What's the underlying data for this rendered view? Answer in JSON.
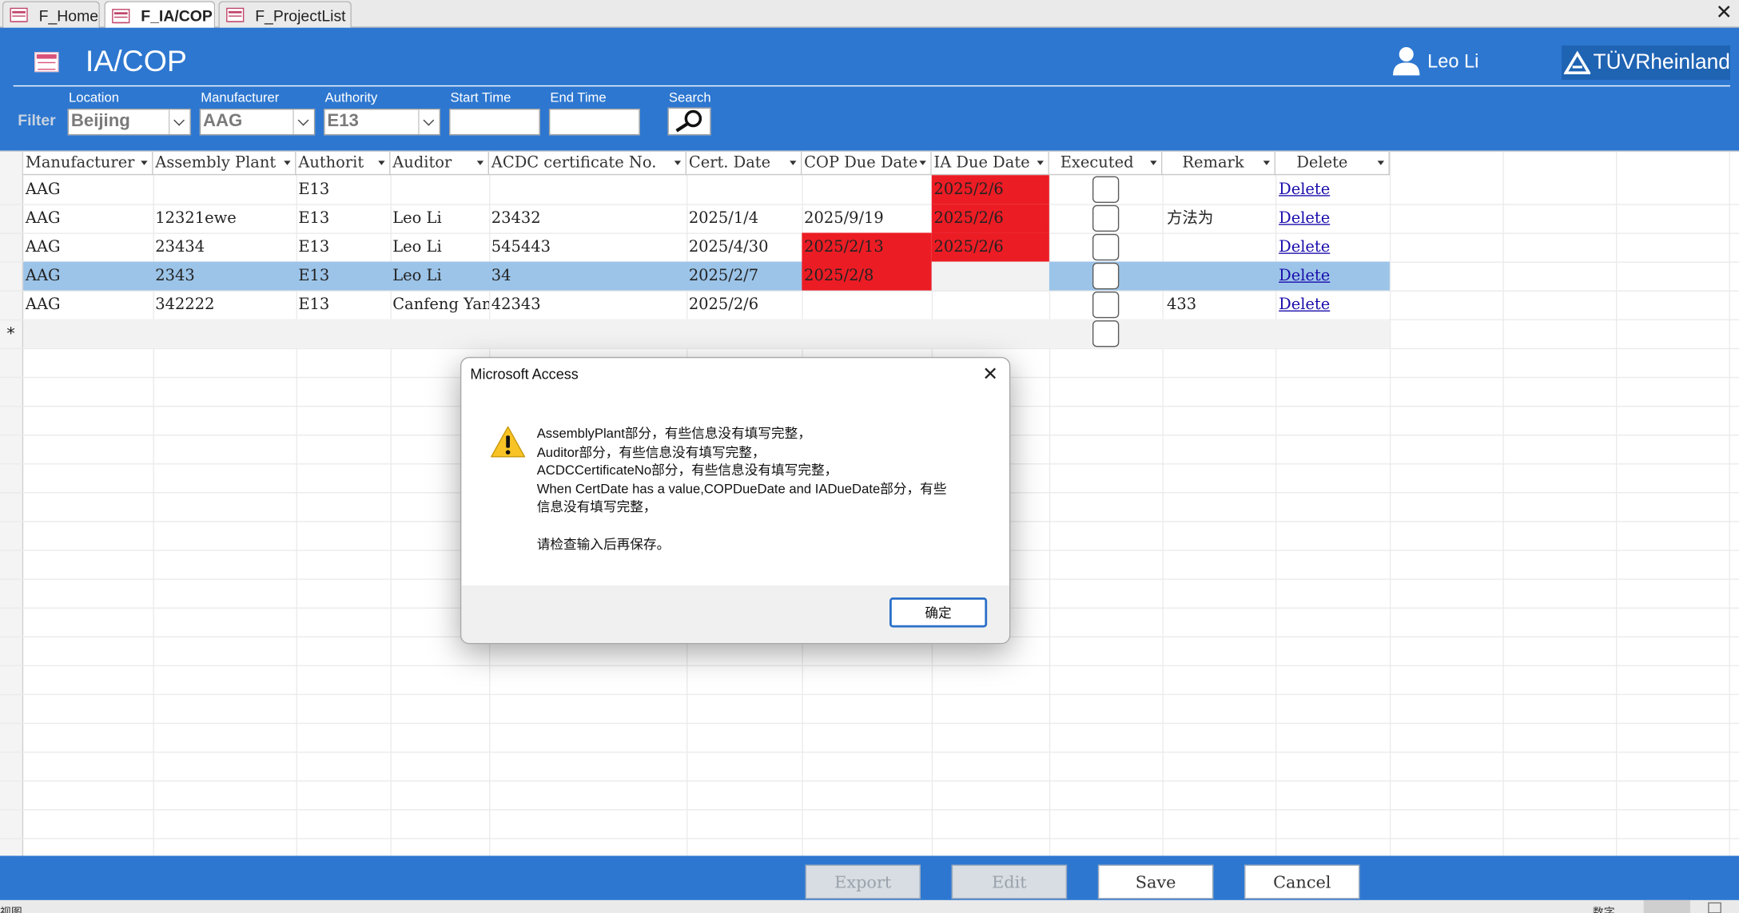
{
  "tabs": [
    {
      "label": "F_Home"
    },
    {
      "label": "F_IA/COP"
    },
    {
      "label": "F_ProjectList"
    }
  ],
  "header": {
    "title": "IA/COP",
    "user_name": "Leo Li",
    "logo_text": "TÜVRheinland"
  },
  "filter": {
    "label": "Filter",
    "location": {
      "label": "Location",
      "value": "Beijing"
    },
    "manufacturer": {
      "label": "Manufacturer",
      "value": "AAG"
    },
    "authority": {
      "label": "Authority",
      "value": "E13"
    },
    "start_time": {
      "label": "Start Time",
      "value": ""
    },
    "end_time": {
      "label": "End Time",
      "value": ""
    },
    "search": {
      "label": "Search"
    }
  },
  "table": {
    "columns": [
      "Manufacturer",
      "Assembly Plant",
      "Authorit",
      "Auditor",
      "ACDC certificate No.",
      "Cert. Date",
      "COP Due Date",
      "IA Due Date",
      "Executed",
      "Remark",
      "Delete"
    ],
    "rows": [
      {
        "manufacturer": "AAG",
        "plant": "",
        "authority": "E13",
        "auditor": "",
        "acdc": "",
        "cert_date": "",
        "cop_due": "",
        "ia_due": "2025/2/6",
        "remark": "",
        "delete": "Delete"
      },
      {
        "manufacturer": "AAG",
        "plant": "12321ewe",
        "authority": "E13",
        "auditor": "Leo Li",
        "acdc": "23432",
        "cert_date": "2025/1/4",
        "cop_due": "2025/9/19",
        "ia_due": "2025/2/6",
        "remark": "方法为",
        "delete": "Delete"
      },
      {
        "manufacturer": "AAG",
        "plant": "23434",
        "authority": "E13",
        "auditor": "Leo Li",
        "acdc": "545443",
        "cert_date": "2025/4/30",
        "cop_due": "2025/2/13",
        "ia_due": "2025/2/6",
        "remark": "",
        "delete": "Delete"
      },
      {
        "manufacturer": "AAG",
        "plant": "2343",
        "authority": "E13",
        "auditor": "Leo Li",
        "acdc": "34",
        "cert_date": "2025/2/7",
        "cop_due": "2025/2/8",
        "ia_due": "",
        "remark": "",
        "delete": "Delete"
      },
      {
        "manufacturer": "AAG",
        "plant": "342222",
        "authority": "E13",
        "auditor": "Canfeng Yan",
        "acdc": "42343",
        "cert_date": "2025/2/6",
        "cop_due": "",
        "ia_due": "",
        "remark": "433",
        "delete": "Delete"
      }
    ],
    "new_row_marker": "*"
  },
  "dialog": {
    "title": "Microsoft Access",
    "lines": [
      "AssemblyPlant部分，有些信息没有填写完整，",
      "Auditor部分，有些信息没有填写完整，",
      "ACDCCertificateNo部分，有些信息没有填写完整，",
      "When CertDate has a value,COPDueDate and IADueDate部分，有些",
      "信息没有填写完整，",
      "",
      "请检查输入后再保存。"
    ],
    "ok_label": "确定"
  },
  "footer": {
    "export": "Export",
    "edit": "Edit",
    "save": "Save",
    "cancel": "Cancel"
  },
  "status": {
    "left": "视图",
    "right": "数字"
  },
  "colors": {
    "accent": "#2d77d0",
    "overdue": "#ec1c24",
    "selected_row": "#9cc4e8"
  }
}
